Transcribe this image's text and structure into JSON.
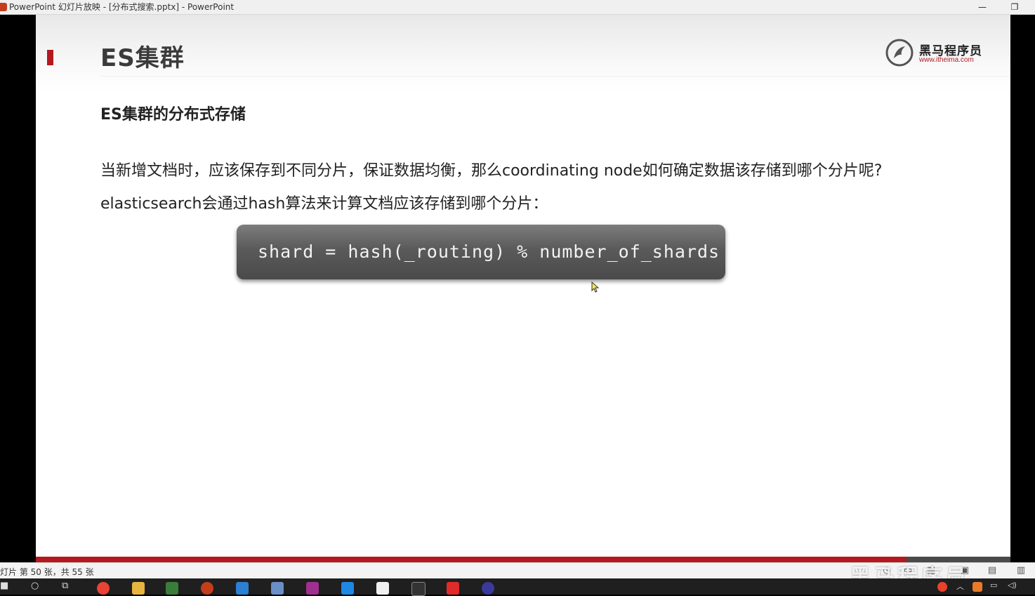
{
  "window": {
    "title": "PowerPoint 幻灯片放映 - [分布式搜索.pptx] - PowerPoint",
    "minimize_glyph": "—",
    "restore_glyph": "❐"
  },
  "slide": {
    "title": "ES集群",
    "subtitle": "ES集群的分布式存储",
    "paragraph1": "当新增文档时，应该保存到不同分片，保证数据均衡，那么coordinating node如何确定数据该存储到哪个分片呢?",
    "paragraph2": "elasticsearch会通过hash算法来计算文档应该存储到哪个分片：",
    "code": "shard = hash(_routing) % number_of_shards",
    "logo": {
      "name": "黑马程序员",
      "url": "www.itheima.com"
    },
    "colors": {
      "accent": "#b3191f",
      "code_bg": "#5a5a5a",
      "text": "#222222"
    }
  },
  "statusbar": {
    "slide_count": "灯片 第 50 张，共 55 张",
    "watermark": "黑马程序员"
  },
  "taskbar": {
    "icons": [
      "windows-icon",
      "search-icon",
      "task-view-icon",
      "chrome-icon",
      "file-explorer-icon",
      "notepad-plus-icon",
      "powerpoint-icon",
      "app-icon",
      "app-icon-2",
      "intellij-icon",
      "vscode-icon",
      "typora-icon",
      "terminal-icon",
      "youdao-icon",
      "eclipse-icon"
    ]
  }
}
